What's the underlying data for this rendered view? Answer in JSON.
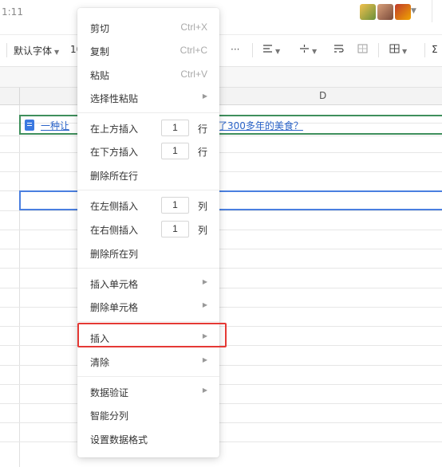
{
  "topbar": {
    "time": "1:11"
  },
  "toolbar": {
    "font": "默认字体",
    "font_size": "10",
    "more": "···",
    "sum": "Σ"
  },
  "grid": {
    "column_d": "D",
    "link_left": "一种让",
    "link_right": "了300多年的美食？"
  },
  "menu": {
    "cut": {
      "label": "剪切",
      "shortcut": "Ctrl+X"
    },
    "copy": {
      "label": "复制",
      "shortcut": "Ctrl+C"
    },
    "paste": {
      "label": "粘贴",
      "shortcut": "Ctrl+V"
    },
    "paste_special": {
      "label": "选择性粘贴"
    },
    "insert_above": {
      "label": "在上方插入",
      "value": "1",
      "unit": "行"
    },
    "insert_below": {
      "label": "在下方插入",
      "value": "1",
      "unit": "行"
    },
    "delete_row": {
      "label": "删除所在行"
    },
    "insert_left": {
      "label": "在左侧插入",
      "value": "1",
      "unit": "列"
    },
    "insert_right": {
      "label": "在右侧插入",
      "value": "1",
      "unit": "列"
    },
    "delete_col": {
      "label": "删除所在列"
    },
    "insert_cell": {
      "label": "插入单元格"
    },
    "delete_cell": {
      "label": "删除单元格"
    },
    "insert": {
      "label": "插入"
    },
    "clear": {
      "label": "清除"
    },
    "data_validation": {
      "label": "数据验证"
    },
    "smart_split": {
      "label": "智能分列"
    },
    "format": {
      "label": "设置数据格式"
    }
  },
  "colors": {
    "highlight": "#e53935",
    "selection_green": "#3f8f5c",
    "selection_blue": "#4a7fe0",
    "link": "#2a63c8"
  }
}
